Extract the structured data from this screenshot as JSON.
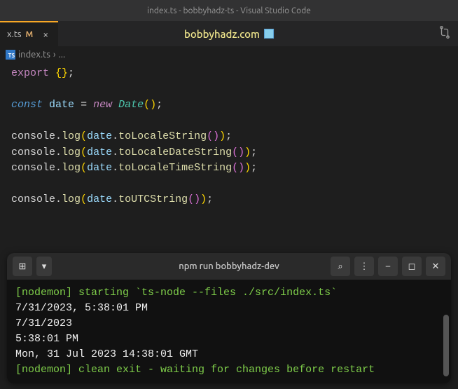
{
  "titleBar": {
    "title": "index.ts - bobbyhadz-ts - Visual Studio Code"
  },
  "tab": {
    "name": "x.ts",
    "modified": "M",
    "close": "×"
  },
  "urlBanner": {
    "text": "bobbyhadz.com"
  },
  "breadcrumb": {
    "file": "index.ts",
    "sep": "›",
    "rest": "..."
  },
  "code": {
    "l1": {
      "export": "export",
      "braces": "{}",
      "semi": ";"
    },
    "l2": {
      "const": "const",
      "varName": "date",
      "eq": "=",
      "new": "new",
      "cls": "Date",
      "pL": "(",
      "pR": ")",
      "semi": ";"
    },
    "l3": {
      "obj": "console",
      "dot1": ".",
      "log": "log",
      "pL1": "(",
      "arg": "date",
      "dot2": ".",
      "method": "toLocaleString",
      "pL2": "(",
      "pR2": ")",
      "pR1": ")",
      "semi": ";"
    },
    "l4": {
      "obj": "console",
      "dot1": ".",
      "log": "log",
      "pL1": "(",
      "arg": "date",
      "dot2": ".",
      "method": "toLocaleDateString",
      "pL2": "(",
      "pR2": ")",
      "pR1": ")",
      "semi": ";"
    },
    "l5": {
      "obj": "console",
      "dot1": ".",
      "log": "log",
      "pL1": "(",
      "arg": "date",
      "dot2": ".",
      "method": "toLocaleTimeString",
      "pL2": "(",
      "pR2": ")",
      "pR1": ")",
      "semi": ";"
    },
    "l6": {
      "obj": "console",
      "dot1": ".",
      "log": "log",
      "pL1": "(",
      "arg": "date",
      "dot2": ".",
      "method": "toUTCString",
      "pL2": "(",
      "pR2": ")",
      "pR1": ")",
      "semi": ";"
    }
  },
  "terminal": {
    "title": "npm run bobbyhadz-dev",
    "icons": {
      "newTab": "⊞",
      "dropdown": "▾",
      "search": "⌕",
      "menu": "⋮",
      "minimize": "–",
      "maximize": "◻",
      "close": "✕"
    },
    "lines": {
      "nodemon1": "[nodemon] starting `ts-node --files ./src/index.ts`",
      "out1": "7/31/2023, 5:38:01 PM",
      "out2": "7/31/2023",
      "out3": "5:38:01 PM",
      "out4": "Mon, 31 Jul 2023 14:38:01 GMT",
      "nodemon2": "[nodemon] clean exit - waiting for changes before restart"
    }
  }
}
